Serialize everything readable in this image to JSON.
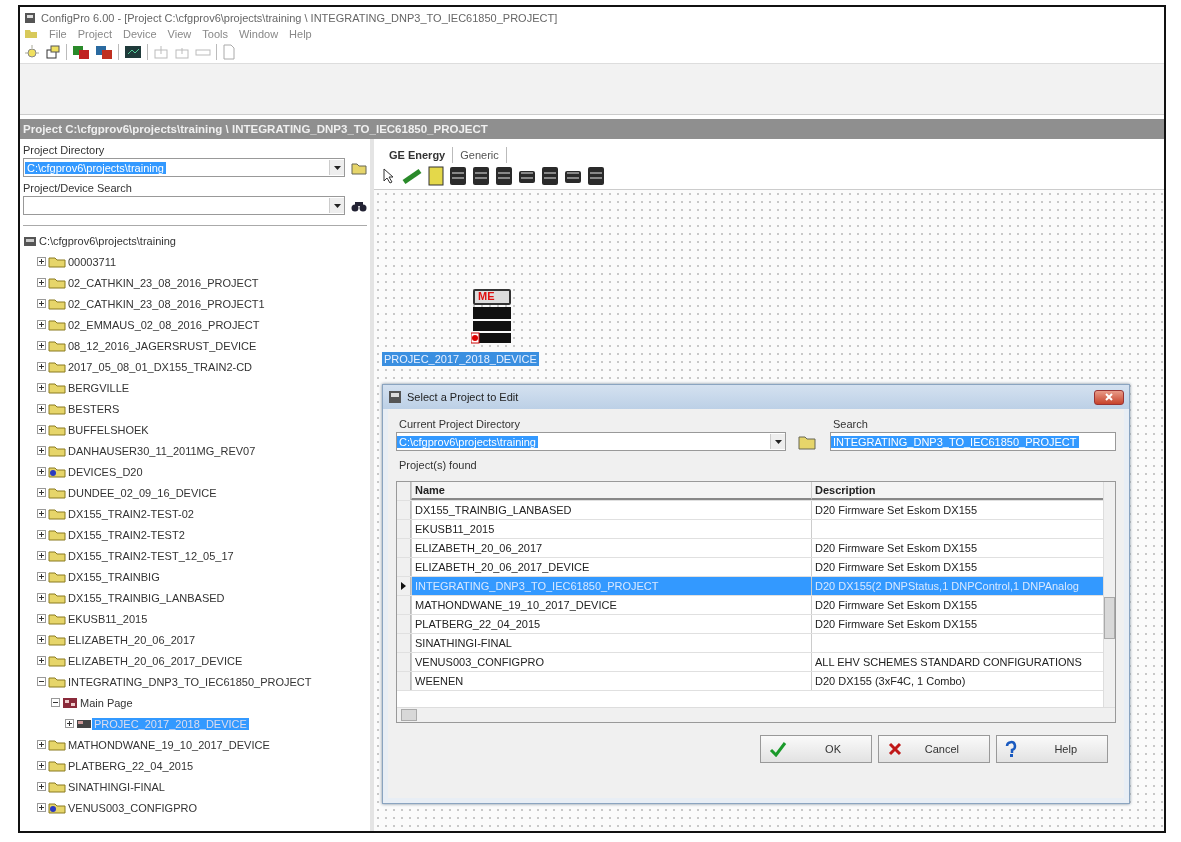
{
  "window": {
    "title": "ConfigPro 6.00 - [Project C:\\cfgprov6\\projects\\training \\ INTEGRATING_DNP3_TO_IEC61850_PROJECT]"
  },
  "menu": [
    "File",
    "Project",
    "Device",
    "View",
    "Tools",
    "Window",
    "Help"
  ],
  "project_bar": {
    "text": "Project C:\\cfgprov6\\projects\\training \\ INTEGRATING_DNP3_TO_IEC61850_PROJECT"
  },
  "left_panel": {
    "directory_label": "Project Directory",
    "directory_value": "C:\\cfgprov6\\projects\\training",
    "search_label": "Project/Device Search"
  },
  "tree": {
    "label": "C:\\cfgprov6\\projects\\training",
    "kind": "root",
    "selected": false,
    "children": [
      {
        "label": "00003711",
        "kind": "folder",
        "expanded": false,
        "selected": false
      },
      {
        "label": "02_CATHKIN_23_08_2016_PROJECT",
        "kind": "folder",
        "expanded": false,
        "selected": false
      },
      {
        "label": "02_CATHKIN_23_08_2016_PROJECT1",
        "kind": "folder",
        "expanded": false,
        "selected": false
      },
      {
        "label": "02_EMMAUS_02_08_2016_PROJECT",
        "kind": "folder",
        "expanded": false,
        "selected": false
      },
      {
        "label": "08_12_2016_JAGERSRUST_DEVICE",
        "kind": "folder",
        "expanded": false,
        "selected": false
      },
      {
        "label": "2017_05_08_01_DX155_TRAIN2-CD",
        "kind": "folder",
        "expanded": false,
        "selected": false
      },
      {
        "label": "BERGVILLE",
        "kind": "folder",
        "expanded": false,
        "selected": false
      },
      {
        "label": "BESTERS",
        "kind": "folder",
        "expanded": false,
        "selected": false
      },
      {
        "label": "BUFFELSHOEK",
        "kind": "folder",
        "expanded": false,
        "selected": false
      },
      {
        "label": "DANHAUSER30_11_2011MG_REV07",
        "kind": "folder",
        "expanded": false,
        "selected": false
      },
      {
        "label": "DEVICES_D20",
        "kind": "device-folder",
        "expanded": false,
        "selected": false
      },
      {
        "label": "DUNDEE_02_09_16_DEVICE",
        "kind": "folder",
        "expanded": false,
        "selected": false
      },
      {
        "label": "DX155_TRAIN2-TEST-02",
        "kind": "folder",
        "expanded": false,
        "selected": false
      },
      {
        "label": "DX155_TRAIN2-TEST2",
        "kind": "folder",
        "expanded": false,
        "selected": false
      },
      {
        "label": "DX155_TRAIN2-TEST_12_05_17",
        "kind": "folder",
        "expanded": false,
        "selected": false
      },
      {
        "label": "DX155_TRAINBIG",
        "kind": "folder",
        "expanded": false,
        "selected": false
      },
      {
        "label": "DX155_TRAINBIG_LANBASED",
        "kind": "folder",
        "expanded": false,
        "selected": false
      },
      {
        "label": "EKUSB11_2015",
        "kind": "folder",
        "expanded": false,
        "selected": false
      },
      {
        "label": "ELIZABETH_20_06_2017",
        "kind": "folder",
        "expanded": false,
        "selected": false
      },
      {
        "label": "ELIZABETH_20_06_2017_DEVICE",
        "kind": "folder",
        "expanded": false,
        "selected": false
      },
      {
        "label": "INTEGRATING_DNP3_TO_IEC61850_PROJECT",
        "kind": "folder",
        "expanded": true,
        "selected": false,
        "children": [
          {
            "label": "Main Page",
            "kind": "page",
            "expanded": true,
            "selected": false,
            "children": [
              {
                "label": "PROJEC_2017_2018_DEVICE",
                "kind": "device",
                "expanded": false,
                "selected": true
              }
            ]
          }
        ]
      },
      {
        "label": "MATHONDWANE_19_10_2017_DEVICE",
        "kind": "folder",
        "expanded": false,
        "selected": false
      },
      {
        "label": "PLATBERG_22_04_2015",
        "kind": "folder",
        "expanded": false,
        "selected": false
      },
      {
        "label": "SINATHINGI-FINAL",
        "kind": "folder",
        "expanded": false,
        "selected": false
      },
      {
        "label": "VENUS003_CONFIGPRO",
        "kind": "device-folder",
        "expanded": false,
        "selected": false
      }
    ]
  },
  "tabs": [
    {
      "label": "GE Energy",
      "selected": true
    },
    {
      "label": "Generic",
      "selected": false
    }
  ],
  "canvas": {
    "device": {
      "badge": "ME",
      "label": "PROJEC_2017_2018_DEVICE",
      "selected": true
    }
  },
  "dialog": {
    "title": "Select a Project to Edit",
    "directory_label": "Current Project Directory",
    "directory_value": "C:\\cfgprov6\\projects\\training",
    "search_label": "Search",
    "search_value": "INTEGRATING_DNP3_TO_IEC61850_PROJECT",
    "found_label": "Project(s) found",
    "columns": [
      "Name",
      "Description"
    ],
    "rows": [
      {
        "name": "DX155_TRAINBIG_LANBASED",
        "description": "D20 Firmware Set Eskom DX155",
        "selected": false
      },
      {
        "name": "EKUSB11_2015",
        "selected": false
      },
      {
        "name": "ELIZABETH_20_06_2017",
        "description": "D20 Firmware Set Eskom DX155",
        "selected": false
      },
      {
        "name": "ELIZABETH_20_06_2017_DEVICE",
        "description": "D20 Firmware Set Eskom DX155",
        "selected": false
      },
      {
        "name": "INTEGRATING_DNP3_TO_IEC61850_PROJECT",
        "description": "D20 DX155(2 DNPStatus,1 DNPControl,1 DNPAnalog",
        "selected": true
      },
      {
        "name": "MATHONDWANE_19_10_2017_DEVICE",
        "description": "D20 Firmware Set Eskom DX155",
        "selected": false
      },
      {
        "name": "PLATBERG_22_04_2015",
        "description": "D20 Firmware Set Eskom DX155",
        "selected": false
      },
      {
        "name": "SINATHINGI-FINAL",
        "selected": false
      },
      {
        "name": "VENUS003_CONFIGPRO",
        "description": "ALL EHV SCHEMES STANDARD CONFIGURATIONS",
        "selected": false
      },
      {
        "name": "WEENEN",
        "description": "D20 DX155 (3xF4C, 1 Combo)",
        "selected": false
      }
    ],
    "buttons": [
      {
        "label": "OK",
        "kind": "ok"
      },
      {
        "label": "Cancel",
        "kind": "cancel"
      },
      {
        "label": "Help",
        "kind": "help"
      }
    ]
  }
}
